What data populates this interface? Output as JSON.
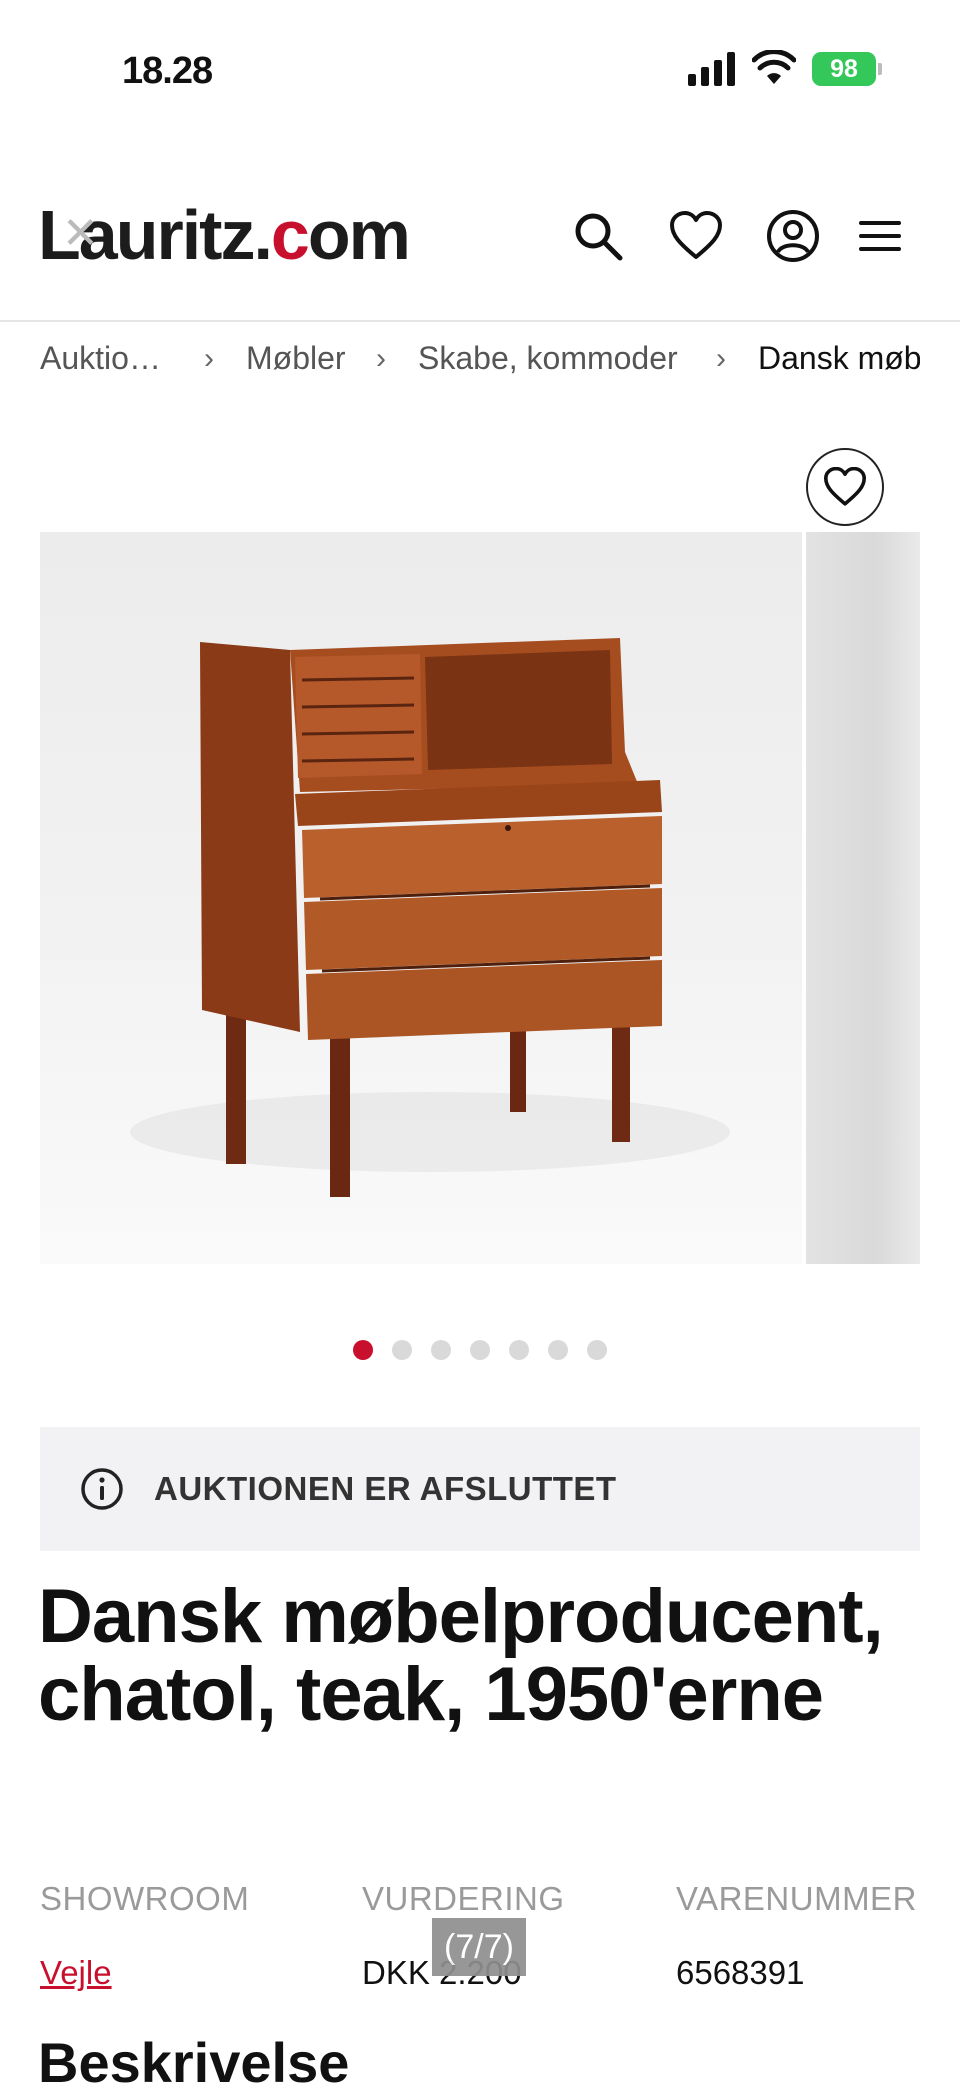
{
  "status_bar": {
    "time": "18.28",
    "battery": "98"
  },
  "header": {
    "logo_prefix": "Lauritz.",
    "logo_accent": "c",
    "logo_suffix": "om"
  },
  "breadcrumb": [
    "Auktio…",
    "Møbler",
    "Skabe, kommoder",
    "Dansk møbelproducent"
  ],
  "gallery": {
    "dot_count": 7,
    "active_dot": 0,
    "counter": "(7/7)"
  },
  "notice": {
    "text": "AUKTIONEN ER AFSLUTTET"
  },
  "item": {
    "title": "Dansk møbelproducent, chatol, teak, 1950'erne",
    "showroom_label": "SHOWROOM",
    "showroom_value": "Vejle",
    "vurdering_label": "VURDERING",
    "vurdering_value": "DKK 2.200",
    "varenummer_label": "VARENUMMER",
    "varenummer_value": "6568391"
  },
  "description": {
    "heading": "Beskrivelse"
  },
  "colors": {
    "accent": "#c8102e",
    "notice_bg": "#f2f2f4",
    "battery": "#34c759"
  },
  "icons": [
    "close-icon",
    "search-icon",
    "heart-icon",
    "user-icon",
    "menu-icon",
    "info-icon"
  ]
}
